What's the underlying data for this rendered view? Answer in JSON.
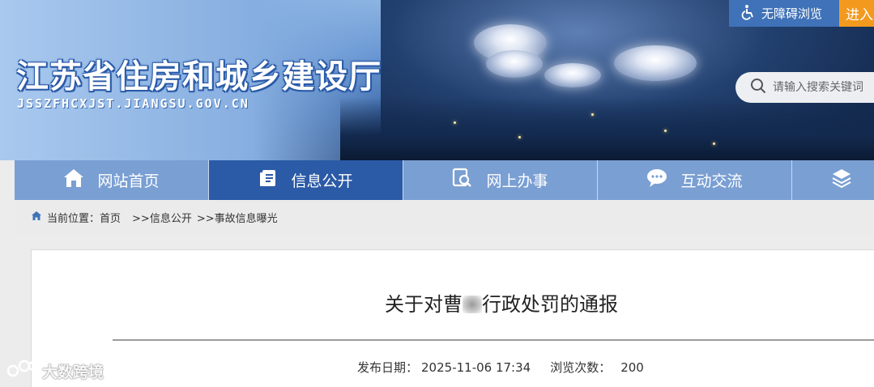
{
  "header": {
    "site_title": "江苏省住房和城乡建设厅",
    "site_domain": "JSSZFHCXJST.JIANGSU.GOV.CN",
    "accessibility_label": "无障碍浏览",
    "enter_label": "进入",
    "search_placeholder": "请输入搜索关键词"
  },
  "nav": {
    "items": [
      {
        "label": "网站首页",
        "icon": "home-icon",
        "active": false
      },
      {
        "label": "信息公开",
        "icon": "document-icon",
        "active": true
      },
      {
        "label": "网上办事",
        "icon": "magnify-document-icon",
        "active": false
      },
      {
        "label": "互动交流",
        "icon": "chat-icon",
        "active": false
      },
      {
        "label": "",
        "icon": "layers-icon",
        "active": false
      }
    ]
  },
  "breadcrumb": {
    "prefix": "当前位置：",
    "items": [
      "首页",
      ">>信息公开",
      ">>事故信息曝光"
    ]
  },
  "article": {
    "title_before": "关于对曹",
    "title_after": "行政处罚的通报",
    "publish_label": "发布日期：",
    "publish_date": "2025-11-06 17:34",
    "views_label": "浏览次数：",
    "views": "200"
  },
  "watermark": {
    "text": "大数跨境"
  },
  "colors": {
    "nav_bg": "#7a9fd3",
    "nav_active": "#2b5aa7",
    "access_btn": "#3f72b8",
    "enter_btn": "#f39a1e"
  }
}
